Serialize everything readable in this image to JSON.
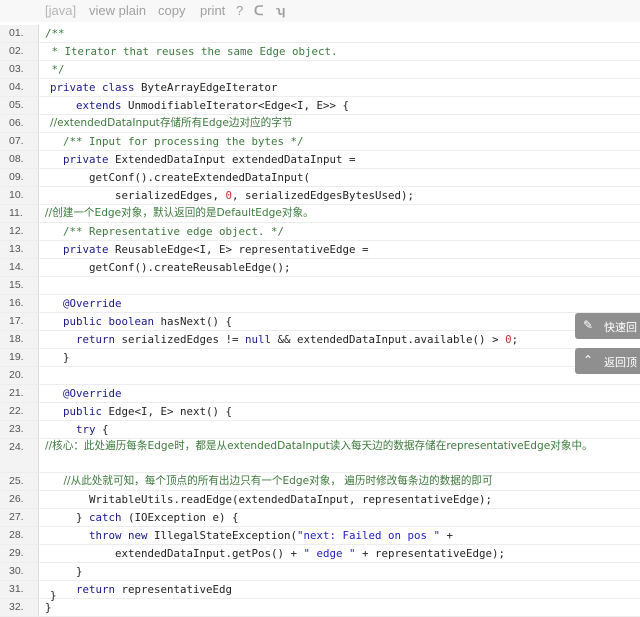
{
  "toolbar": {
    "lang": "[java]",
    "view_plain": "view plain",
    "copy": "copy",
    "print": "print",
    "help": "?",
    "icon1_glyph": "ᑕ",
    "icon2_glyph": "ʮ"
  },
  "lines": [
    {
      "n": "01.",
      "indent": "45",
      "segs": [
        {
          "t": "/**",
          "c": "c"
        }
      ]
    },
    {
      "n": "02.",
      "indent": "45",
      "segs": [
        {
          "t": " * Iterator that reuses the same Edge object.",
          "c": "c"
        }
      ]
    },
    {
      "n": "03.",
      "indent": "45",
      "segs": [
        {
          "t": " */",
          "c": "c"
        }
      ]
    },
    {
      "n": "04.",
      "indent": "50",
      "segs": [
        {
          "t": "private class ",
          "c": "k"
        },
        {
          "t": "ByteArrayEdgeIterator",
          "c": ""
        }
      ]
    },
    {
      "n": "05.",
      "indent": "50",
      "segs": [
        {
          "t": "    extends ",
          "c": "k"
        },
        {
          "t": "UnmodifiableIterator<Edge<I, E>> {",
          "c": ""
        }
      ]
    },
    {
      "n": "06.",
      "indent": "50",
      "cjk": true,
      "segs": [
        {
          "t": "//extendedDataInput存储所有Edge边对应的字节",
          "c": "c"
        }
      ]
    },
    {
      "n": "07.",
      "indent": "50",
      "segs": [
        {
          "t": "  /** Input for processing the bytes */",
          "c": "c"
        }
      ]
    },
    {
      "n": "08.",
      "indent": "50",
      "segs": [
        {
          "t": "  private ",
          "c": "k"
        },
        {
          "t": "ExtendedDataInput extendedDataInput =",
          "c": ""
        }
      ]
    },
    {
      "n": "09.",
      "indent": "50",
      "segs": [
        {
          "t": "      getConf().createExtendedDataInput(",
          "c": ""
        }
      ]
    },
    {
      "n": "10.",
      "indent": "50",
      "segs": [
        {
          "t": "          serializedEdges, ",
          "c": ""
        },
        {
          "t": "0",
          "c": "n"
        },
        {
          "t": ", serializedEdgesBytesUsed);",
          "c": ""
        }
      ]
    },
    {
      "n": "11.",
      "indent": "45",
      "cjk": true,
      "segs": [
        {
          "t": "//创建一个Edge对象，默认返回的是DefaultEdge对象。",
          "c": "c"
        }
      ]
    },
    {
      "n": "12.",
      "indent": "50",
      "segs": [
        {
          "t": "  /** Representative edge object. */",
          "c": "c"
        }
      ]
    },
    {
      "n": "13.",
      "indent": "50",
      "segs": [
        {
          "t": "  private ",
          "c": "k"
        },
        {
          "t": "ReusableEdge<I, E> representativeEdge =",
          "c": ""
        }
      ]
    },
    {
      "n": "14.",
      "indent": "50",
      "segs": [
        {
          "t": "      getConf().createReusableEdge();",
          "c": ""
        }
      ]
    },
    {
      "n": "15.",
      "indent": "50",
      "segs": []
    },
    {
      "n": "16.",
      "indent": "50",
      "segs": [
        {
          "t": "  @Override",
          "c": "k"
        }
      ]
    },
    {
      "n": "17.",
      "indent": "50",
      "segs": [
        {
          "t": "  public boolean ",
          "c": "k"
        },
        {
          "t": "hasNext() {",
          "c": ""
        }
      ]
    },
    {
      "n": "18.",
      "indent": "50",
      "segs": [
        {
          "t": "    return ",
          "c": "k"
        },
        {
          "t": "serializedEdges != ",
          "c": ""
        },
        {
          "t": "null",
          "c": "k"
        },
        {
          "t": " && extendedDataInput.available() > ",
          "c": ""
        },
        {
          "t": "0",
          "c": "n"
        },
        {
          "t": ";",
          "c": ""
        }
      ]
    },
    {
      "n": "19.",
      "indent": "50",
      "segs": [
        {
          "t": "  }",
          "c": ""
        }
      ]
    },
    {
      "n": "20.",
      "indent": "50",
      "segs": []
    },
    {
      "n": "21.",
      "indent": "50",
      "segs": [
        {
          "t": "  @Override",
          "c": "k"
        }
      ]
    },
    {
      "n": "22.",
      "indent": "50",
      "segs": [
        {
          "t": "  public ",
          "c": "k"
        },
        {
          "t": "Edge<I, E> next() {",
          "c": ""
        }
      ]
    },
    {
      "n": "23.",
      "indent": "50",
      "segs": [
        {
          "t": "    try ",
          "c": "k"
        },
        {
          "t": "{",
          "c": ""
        }
      ]
    },
    {
      "n": "24.",
      "indent": "45",
      "cjk": true,
      "wrap": true,
      "segs": [
        {
          "t": "    //核心：此处遍历每条Edge时，都是从extendedDataInput读入每天边的数据存储在representativeEdge对象中。",
          "c": "c"
        }
      ]
    },
    {
      "n": "25.",
      "indent": "50",
      "cjk": true,
      "segs": [
        {
          "t": "    //从此处就可知，每个顶点的所有出边只有一个Edge对象， 遍历时修改每条边的数据的即可",
          "c": "c"
        }
      ]
    },
    {
      "n": "26.",
      "indent": "50",
      "segs": [
        {
          "t": "      WritableUtils.readEdge(extendedDataInput, representativeEdge);",
          "c": ""
        }
      ]
    },
    {
      "n": "27.",
      "indent": "50",
      "segs": [
        {
          "t": "    } ",
          "c": ""
        },
        {
          "t": "catch ",
          "c": "k"
        },
        {
          "t": "(IOException e) {",
          "c": ""
        }
      ]
    },
    {
      "n": "28.",
      "indent": "50",
      "segs": [
        {
          "t": "      throw new ",
          "c": "k"
        },
        {
          "t": "IllegalStateException(",
          "c": ""
        },
        {
          "t": "\"next: Failed on pos \"",
          "c": "s"
        },
        {
          "t": " +",
          "c": ""
        }
      ]
    },
    {
      "n": "29.",
      "indent": "50",
      "segs": [
        {
          "t": "          extendedDataInput.getPos() + ",
          "c": ""
        },
        {
          "t": "\" edge \"",
          "c": "s"
        },
        {
          "t": " + representativeEdge);",
          "c": ""
        }
      ]
    },
    {
      "n": "30.",
      "indent": "50",
      "segs": [
        {
          "t": "    }",
          "c": ""
        }
      ]
    },
    {
      "n": "31.",
      "indent": "50",
      "segs": [
        {
          "t": "    return ",
          "c": "k"
        },
        {
          "t": "representativeEdg",
          "c": ""
        }
      ]
    },
    {
      "n": "32.",
      "indent": "45",
      "segs": [
        {
          "t": "}",
          "c": ""
        }
      ]
    }
  ],
  "last_brace": "}",
  "float_buttons": [
    {
      "label": "快速回",
      "icon": "✎"
    },
    {
      "label": "返回顶",
      "icon": "⌃"
    }
  ]
}
